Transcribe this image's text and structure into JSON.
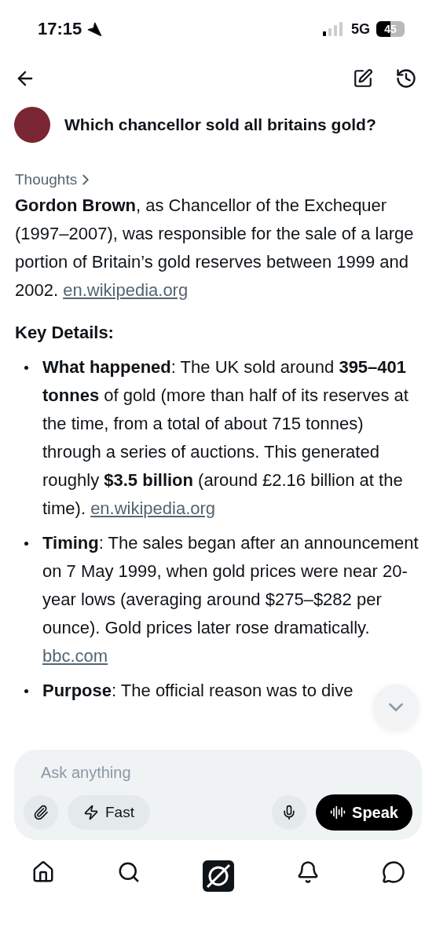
{
  "status_bar": {
    "time": "17:15",
    "network": "5G",
    "battery": "45"
  },
  "question": "Which chancellor sold all britains gold?",
  "thoughts": "Thoughts",
  "answer": {
    "intro": {
      "text": "**Gordon Brown**, as Chancellor of the Exchequer (1997–2007), was responsible for the sale of a large portion of Britain’s gold reserves between 1999 and 2002.",
      "link": "en.wikipedia.org"
    },
    "heading": "Key Details:",
    "bullets": [
      {
        "text": "**What happened**: The UK sold around **395–401 tonnes** of gold (more than half of its reserves at the time, from a total of about 715 tonnes) through a series of auctions. This generated roughly **$3.5 billion** (around £2.16 billion at the time).",
        "link": "en.wikipedia.org"
      },
      {
        "text": "**Timing**: The sales began after an announcement on 7 May 1999, when gold prices were near 20-year lows (averaging around $275–$282 per ounce). Gold prices later rose dramatically.",
        "link": "bbc.com"
      },
      {
        "text": "**Purpose**: The official reason was to dive"
      }
    ]
  },
  "composer": {
    "placeholder": "Ask anything",
    "mode": "Fast",
    "speak": "Speak"
  }
}
